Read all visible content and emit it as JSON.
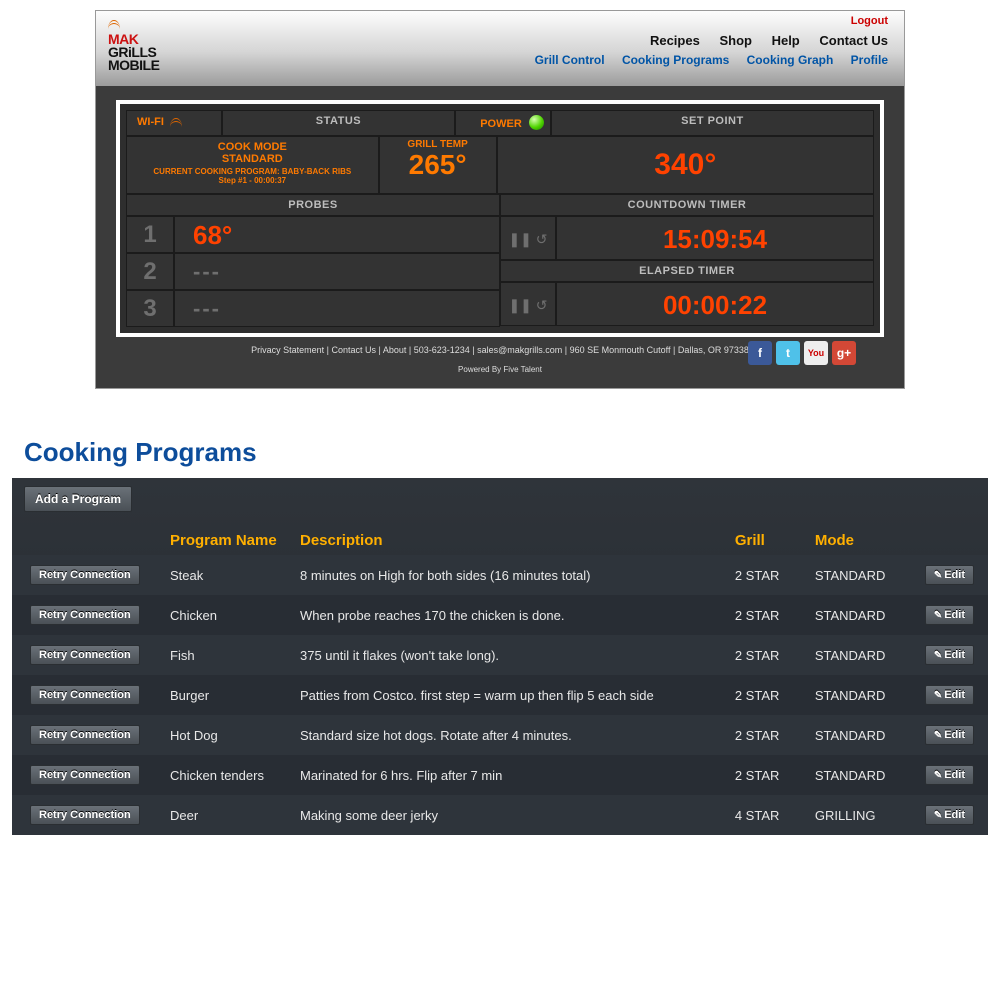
{
  "logo": {
    "line1": "MAK",
    "line2": "GRiLLS",
    "line3": "MOBILE"
  },
  "topbar": {
    "logout": "Logout",
    "nav1": [
      "Recipes",
      "Shop",
      "Help",
      "Contact Us"
    ],
    "nav2": [
      "Grill Control",
      "Cooking Programs",
      "Cooking Graph",
      "Profile"
    ]
  },
  "dash": {
    "wifi_label": "WI-FI",
    "status_label": "STATUS",
    "power_label": "POWER",
    "setpoint_label": "SET POINT",
    "cook_mode_line1": "COOK MODE",
    "cook_mode_line2": "STANDARD",
    "current_prog": "CURRENT COOKING PROGRAM: BABY-BACK RIBS",
    "current_step": "Step #1 - 00:00:37",
    "grill_temp_label": "GRILL TEMP",
    "grill_temp": "265°",
    "setpoint": "340°",
    "probes_label": "PROBES",
    "countdown_label": "COUNTDOWN TIMER",
    "elapsed_label": "ELAPSED TIMER",
    "probes": [
      {
        "n": "1",
        "v": "68°",
        "empty": false
      },
      {
        "n": "2",
        "v": "---",
        "empty": true
      },
      {
        "n": "3",
        "v": "---",
        "empty": true
      }
    ],
    "countdown": "15:09:54",
    "elapsed": "00:00:22",
    "timer_ctrl": "❚❚ ↺"
  },
  "footer": {
    "links": "Privacy Statement | Contact Us | About | 503-623-1234 | sales@makgrills.com | 960 SE Monmouth Cutoff | Dallas, OR 97338",
    "powered": "Powered By Five Talent",
    "social": {
      "fb": "f",
      "tw": "t",
      "yt": "You",
      "gp": "g+"
    }
  },
  "cp": {
    "title": "Cooking Programs",
    "add_label": "Add a Program",
    "retry_label": "Retry Connection",
    "edit_label": "Edit",
    "headers": {
      "name": "Program Name",
      "desc": "Description",
      "grill": "Grill",
      "mode": "Mode"
    },
    "rows": [
      {
        "name": "Steak",
        "desc": "8 minutes on High for both sides (16 minutes total)",
        "grill": "2 STAR",
        "mode": "STANDARD"
      },
      {
        "name": "Chicken",
        "desc": "When probe reaches 170 the chicken is done.",
        "grill": "2 STAR",
        "mode": "STANDARD"
      },
      {
        "name": "Fish",
        "desc": "375 until it flakes (won't take long).",
        "grill": "2 STAR",
        "mode": "STANDARD"
      },
      {
        "name": "Burger",
        "desc": "Patties from Costco. first step = warm up then flip 5 each side",
        "grill": "2 STAR",
        "mode": "STANDARD"
      },
      {
        "name": "Hot Dog",
        "desc": "Standard size hot dogs. Rotate after 4 minutes.",
        "grill": "2 STAR",
        "mode": "STANDARD"
      },
      {
        "name": "Chicken tenders",
        "desc": "Marinated for 6 hrs. Flip after 7 min",
        "grill": "2 STAR",
        "mode": "STANDARD"
      },
      {
        "name": "Deer",
        "desc": "Making some deer jerky",
        "grill": "4 STAR",
        "mode": "GRILLING"
      }
    ]
  }
}
